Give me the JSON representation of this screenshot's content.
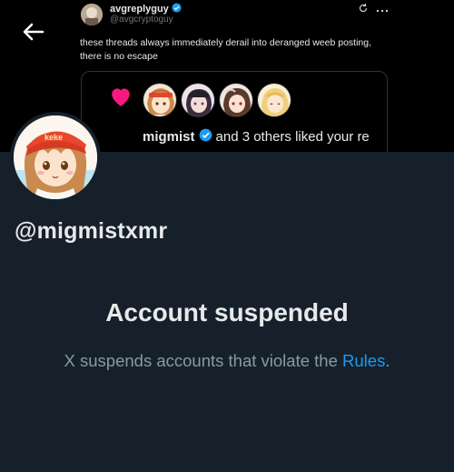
{
  "tweet": {
    "display_name": "avgreplyguy",
    "handle": "@avgcryptoguy",
    "text": "these threads always immediately derail into deranged weeb posting, there is no escape",
    "more_icon": "more-dots-icon",
    "refresh_icon": "refresh-icon"
  },
  "like_card": {
    "liker_name": "migmist",
    "like_text": "and 3 others liked your re",
    "icon": "heart-icon"
  },
  "profile": {
    "username": "@migmistxmr",
    "avatar_caption": "keke"
  },
  "suspension": {
    "title": "Account suspended",
    "message_prefix": "X suspends accounts that violate the ",
    "rules_link": "Rules",
    "message_suffix": "."
  },
  "colors": {
    "background": "#15202b",
    "link": "#1d9bf0",
    "verified": "#1d9bf0",
    "heart": "#f91880"
  }
}
